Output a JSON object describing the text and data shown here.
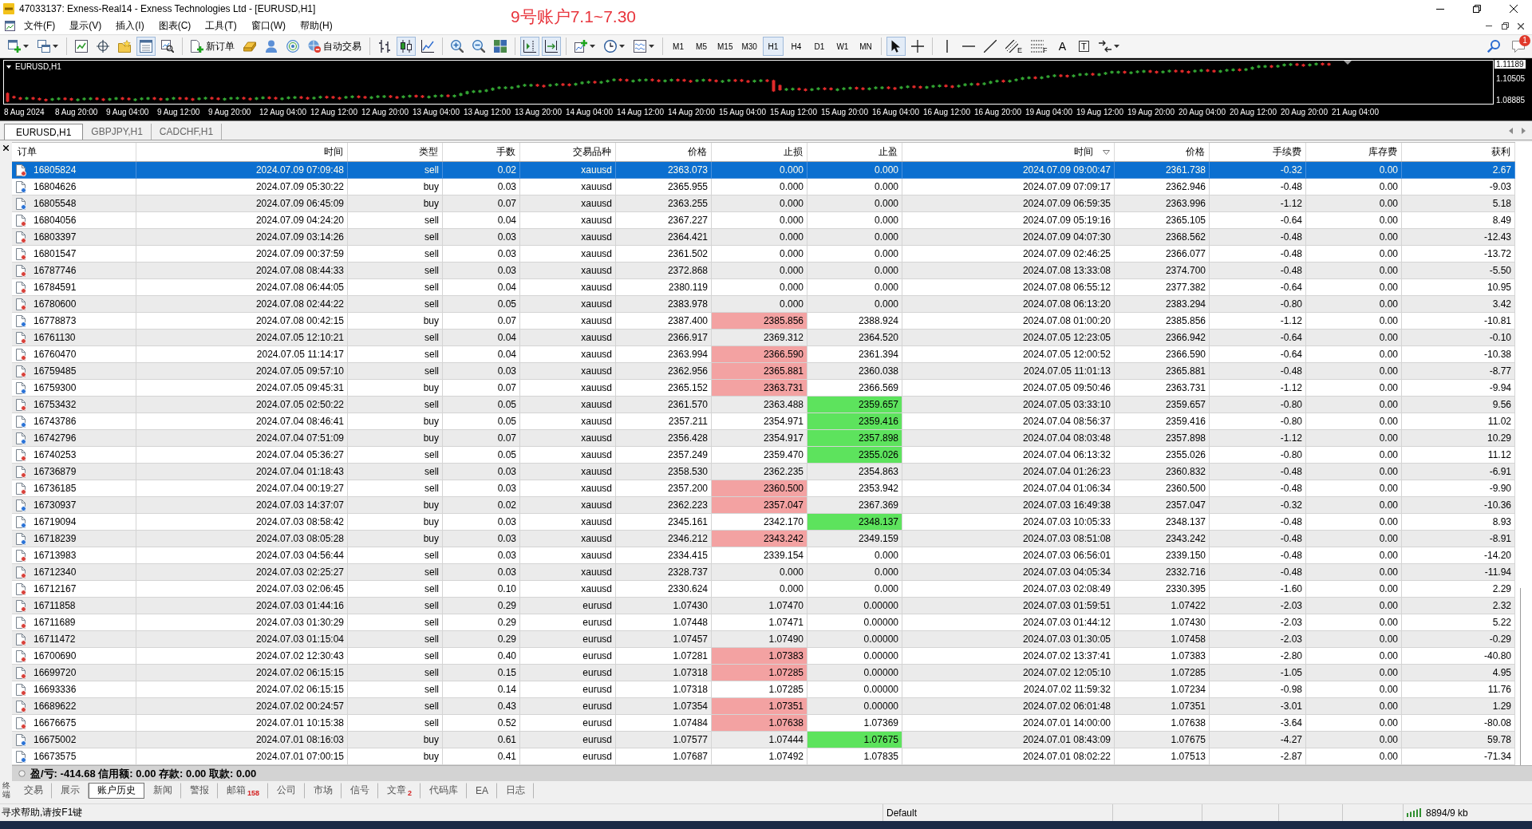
{
  "window": {
    "title": "47033137: Exness-Real14 - Exness Technologies Ltd - [EURUSD,H1]"
  },
  "annotation": "9号账户7.1~7.30",
  "menu": [
    "文件(F)",
    "显示(V)",
    "插入(I)",
    "图表(C)",
    "工具(T)",
    "窗口(W)",
    "帮助(H)"
  ],
  "toolbar": [
    [
      {
        "kind": "newchart",
        "on": false,
        "dropdown": true
      },
      {
        "kind": "profiles",
        "on": false,
        "dropdown": true
      }
    ],
    [
      {
        "kind": "marketwatch",
        "on": false
      },
      {
        "kind": "datawindow",
        "on": false
      },
      {
        "kind": "navigator",
        "on": false
      },
      {
        "kind": "terminal",
        "on": true
      },
      {
        "kind": "tester",
        "on": false
      }
    ],
    [
      {
        "kind": "neworder",
        "label": "新订单",
        "on": false
      },
      {
        "kind": "editor",
        "on": false
      },
      {
        "kind": "account",
        "on": false
      },
      {
        "kind": "signals",
        "on": false
      },
      {
        "kind": "autotrading",
        "label": "自动交易",
        "on": false
      }
    ],
    [
      {
        "kind": "bars",
        "on": false
      },
      {
        "kind": "candles",
        "on": true
      },
      {
        "kind": "line",
        "on": false
      }
    ],
    [
      {
        "kind": "zoomin",
        "on": false
      },
      {
        "kind": "zoomout",
        "on": false
      },
      {
        "kind": "tile",
        "on": false
      }
    ],
    [
      {
        "kind": "shift",
        "on": true
      },
      {
        "kind": "autoscroll",
        "on": true
      }
    ],
    [
      {
        "kind": "indicators",
        "on": false,
        "dropdown": true
      },
      {
        "kind": "periods",
        "on": false,
        "dropdown": true
      },
      {
        "kind": "templates",
        "on": false,
        "dropdown": true
      }
    ],
    [
      {
        "kind": "timeframe",
        "label": "M1",
        "on": false
      },
      {
        "kind": "timeframe",
        "label": "M5",
        "on": false
      },
      {
        "kind": "timeframe",
        "label": "M15",
        "on": false
      },
      {
        "kind": "timeframe",
        "label": "M30",
        "on": false
      },
      {
        "kind": "timeframe",
        "label": "H1",
        "on": true
      },
      {
        "kind": "timeframe",
        "label": "H4",
        "on": false
      },
      {
        "kind": "timeframe",
        "label": "D1",
        "on": false
      },
      {
        "kind": "timeframe",
        "label": "W1",
        "on": false
      },
      {
        "kind": "timeframe",
        "label": "MN",
        "on": false
      }
    ],
    [
      {
        "kind": "cursor",
        "on": true
      },
      {
        "kind": "crosshair",
        "on": false
      }
    ],
    [
      {
        "kind": "vline",
        "on": false
      },
      {
        "kind": "hline",
        "on": false
      },
      {
        "kind": "trendline",
        "on": false
      },
      {
        "kind": "channel",
        "label": "E",
        "on": false
      },
      {
        "kind": "fibo",
        "label": "F",
        "on": false
      },
      {
        "kind": "text",
        "label": "A",
        "on": false
      },
      {
        "kind": "label",
        "label": "T",
        "on": false
      },
      {
        "kind": "arrows",
        "on": false,
        "dropdown": true
      }
    ]
  ],
  "toolbar_right": [
    {
      "kind": "search"
    },
    {
      "kind": "alerts",
      "badge": "1"
    }
  ],
  "chart": {
    "symbol": "EURUSD,H1",
    "price_labels": [
      {
        "text": "1.11189",
        "current": true
      },
      {
        "text": "1.10505",
        "current": false
      },
      {
        "text": "1.08885",
        "current": false
      }
    ],
    "time_labels": [
      "8 Aug 2024",
      "8 Aug 20:00",
      "9 Aug 04:00",
      "9 Aug 12:00",
      "9 Aug 20:00",
      "12 Aug 04:00",
      "12 Aug 12:00",
      "12 Aug 20:00",
      "13 Aug 04:00",
      "13 Aug 12:00",
      "13 Aug 20:00",
      "14 Aug 04:00",
      "14 Aug 12:00",
      "14 Aug 20:00",
      "15 Aug 04:00",
      "15 Aug 12:00",
      "15 Aug 20:00",
      "16 Aug 04:00",
      "16 Aug 12:00",
      "16 Aug 20:00",
      "19 Aug 04:00",
      "19 Aug 12:00",
      "19 Aug 20:00",
      "20 Aug 04:00",
      "20 Aug 12:00",
      "20 Aug 20:00",
      "21 Aug 04:00"
    ]
  },
  "chart_tabs": [
    {
      "label": "EURUSD,H1",
      "selected": true
    },
    {
      "label": "GBPJPY,H1",
      "selected": false
    },
    {
      "label": "CADCHF,H1",
      "selected": false
    }
  ],
  "table": {
    "columns": [
      {
        "label": "订单",
        "sorted": false
      },
      {
        "label": "时间",
        "sorted": false
      },
      {
        "label": "类型",
        "sorted": false
      },
      {
        "label": "手数",
        "sorted": false
      },
      {
        "label": "交易品种",
        "sorted": false
      },
      {
        "label": "价格",
        "sorted": false
      },
      {
        "label": "止损",
        "sorted": false
      },
      {
        "label": "止盈",
        "sorted": false
      },
      {
        "label": "时间",
        "sorted": true
      },
      {
        "label": "价格",
        "sorted": false
      },
      {
        "label": "手续费",
        "sorted": false
      },
      {
        "label": "库存费",
        "sorted": false
      },
      {
        "label": "获利",
        "sorted": false
      }
    ],
    "rows": [
      {
        "kind": "sell",
        "selected": true,
        "sl_hit": false,
        "tp_hit": false,
        "cells": [
          "16805824",
          "2024.07.09 07:09:48",
          "sell",
          "0.02",
          "xauusd",
          "2363.073",
          "0.000",
          "0.000",
          "2024.07.09 09:00:47",
          "2361.738",
          "-0.32",
          "0.00",
          "2.67"
        ]
      },
      {
        "kind": "buy",
        "selected": false,
        "sl_hit": false,
        "tp_hit": false,
        "cells": [
          "16804626",
          "2024.07.09 05:30:22",
          "buy",
          "0.03",
          "xauusd",
          "2365.955",
          "0.000",
          "0.000",
          "2024.07.09 07:09:17",
          "2362.946",
          "-0.48",
          "0.00",
          "-9.03"
        ]
      },
      {
        "kind": "buy",
        "selected": false,
        "sl_hit": false,
        "tp_hit": false,
        "cells": [
          "16805548",
          "2024.07.09 06:45:09",
          "buy",
          "0.07",
          "xauusd",
          "2363.255",
          "0.000",
          "0.000",
          "2024.07.09 06:59:35",
          "2363.996",
          "-1.12",
          "0.00",
          "5.18"
        ]
      },
      {
        "kind": "sell",
        "selected": false,
        "sl_hit": false,
        "tp_hit": false,
        "cells": [
          "16804056",
          "2024.07.09 04:24:20",
          "sell",
          "0.04",
          "xauusd",
          "2367.227",
          "0.000",
          "0.000",
          "2024.07.09 05:19:16",
          "2365.105",
          "-0.64",
          "0.00",
          "8.49"
        ]
      },
      {
        "kind": "sell",
        "selected": false,
        "sl_hit": false,
        "tp_hit": false,
        "cells": [
          "16803397",
          "2024.07.09 03:14:26",
          "sell",
          "0.03",
          "xauusd",
          "2364.421",
          "0.000",
          "0.000",
          "2024.07.09 04:07:30",
          "2368.562",
          "-0.48",
          "0.00",
          "-12.43"
        ]
      },
      {
        "kind": "sell",
        "selected": false,
        "sl_hit": false,
        "tp_hit": false,
        "cells": [
          "16801547",
          "2024.07.09 00:37:59",
          "sell",
          "0.03",
          "xauusd",
          "2361.502",
          "0.000",
          "0.000",
          "2024.07.09 02:46:25",
          "2366.077",
          "-0.48",
          "0.00",
          "-13.72"
        ]
      },
      {
        "kind": "sell",
        "selected": false,
        "sl_hit": false,
        "tp_hit": false,
        "cells": [
          "16787746",
          "2024.07.08 08:44:33",
          "sell",
          "0.03",
          "xauusd",
          "2372.868",
          "0.000",
          "0.000",
          "2024.07.08 13:33:08",
          "2374.700",
          "-0.48",
          "0.00",
          "-5.50"
        ]
      },
      {
        "kind": "sell",
        "selected": false,
        "sl_hit": false,
        "tp_hit": false,
        "cells": [
          "16784591",
          "2024.07.08 06:44:05",
          "sell",
          "0.04",
          "xauusd",
          "2380.119",
          "0.000",
          "0.000",
          "2024.07.08 06:55:12",
          "2377.382",
          "-0.64",
          "0.00",
          "10.95"
        ]
      },
      {
        "kind": "sell",
        "selected": false,
        "sl_hit": false,
        "tp_hit": false,
        "cells": [
          "16780600",
          "2024.07.08 02:44:22",
          "sell",
          "0.05",
          "xauusd",
          "2383.978",
          "0.000",
          "0.000",
          "2024.07.08 06:13:20",
          "2383.294",
          "-0.80",
          "0.00",
          "3.42"
        ]
      },
      {
        "kind": "buy",
        "selected": false,
        "sl_hit": true,
        "tp_hit": false,
        "cells": [
          "16778873",
          "2024.07.08 00:42:15",
          "buy",
          "0.07",
          "xauusd",
          "2387.400",
          "2385.856",
          "2388.924",
          "2024.07.08 01:00:20",
          "2385.856",
          "-1.12",
          "0.00",
          "-10.81"
        ]
      },
      {
        "kind": "sell",
        "selected": false,
        "sl_hit": false,
        "tp_hit": false,
        "cells": [
          "16761130",
          "2024.07.05 12:10:21",
          "sell",
          "0.04",
          "xauusd",
          "2366.917",
          "2369.312",
          "2364.520",
          "2024.07.05 12:23:05",
          "2366.942",
          "-0.64",
          "0.00",
          "-0.10"
        ]
      },
      {
        "kind": "sell",
        "selected": false,
        "sl_hit": true,
        "tp_hit": false,
        "cells": [
          "16760470",
          "2024.07.05 11:14:17",
          "sell",
          "0.04",
          "xauusd",
          "2363.994",
          "2366.590",
          "2361.394",
          "2024.07.05 12:00:52",
          "2366.590",
          "-0.64",
          "0.00",
          "-10.38"
        ]
      },
      {
        "kind": "sell",
        "selected": false,
        "sl_hit": true,
        "tp_hit": false,
        "cells": [
          "16759485",
          "2024.07.05 09:57:10",
          "sell",
          "0.03",
          "xauusd",
          "2362.956",
          "2365.881",
          "2360.038",
          "2024.07.05 11:01:13",
          "2365.881",
          "-0.48",
          "0.00",
          "-8.77"
        ]
      },
      {
        "kind": "buy",
        "selected": false,
        "sl_hit": true,
        "tp_hit": false,
        "cells": [
          "16759300",
          "2024.07.05 09:45:31",
          "buy",
          "0.07",
          "xauusd",
          "2365.152",
          "2363.731",
          "2366.569",
          "2024.07.05 09:50:46",
          "2363.731",
          "-1.12",
          "0.00",
          "-9.94"
        ]
      },
      {
        "kind": "sell",
        "selected": false,
        "sl_hit": false,
        "tp_hit": true,
        "cells": [
          "16753432",
          "2024.07.05 02:50:22",
          "sell",
          "0.05",
          "xauusd",
          "2361.570",
          "2363.488",
          "2359.657",
          "2024.07.05 03:33:10",
          "2359.657",
          "-0.80",
          "0.00",
          "9.56"
        ]
      },
      {
        "kind": "buy",
        "selected": false,
        "sl_hit": false,
        "tp_hit": true,
        "cells": [
          "16743786",
          "2024.07.04 08:46:41",
          "buy",
          "0.05",
          "xauusd",
          "2357.211",
          "2354.971",
          "2359.416",
          "2024.07.04 08:56:37",
          "2359.416",
          "-0.80",
          "0.00",
          "11.02"
        ]
      },
      {
        "kind": "buy",
        "selected": false,
        "sl_hit": false,
        "tp_hit": true,
        "cells": [
          "16742796",
          "2024.07.04 07:51:09",
          "buy",
          "0.07",
          "xauusd",
          "2356.428",
          "2354.917",
          "2357.898",
          "2024.07.04 08:03:48",
          "2357.898",
          "-1.12",
          "0.00",
          "10.29"
        ]
      },
      {
        "kind": "sell",
        "selected": false,
        "sl_hit": false,
        "tp_hit": true,
        "cells": [
          "16740253",
          "2024.07.04 05:36:27",
          "sell",
          "0.05",
          "xauusd",
          "2357.249",
          "2359.470",
          "2355.026",
          "2024.07.04 06:13:32",
          "2355.026",
          "-0.80",
          "0.00",
          "11.12"
        ]
      },
      {
        "kind": "sell",
        "selected": false,
        "sl_hit": false,
        "tp_hit": false,
        "cells": [
          "16736879",
          "2024.07.04 01:18:43",
          "sell",
          "0.03",
          "xauusd",
          "2358.530",
          "2362.235",
          "2354.863",
          "2024.07.04 01:26:23",
          "2360.832",
          "-0.48",
          "0.00",
          "-6.91"
        ]
      },
      {
        "kind": "sell",
        "selected": false,
        "sl_hit": true,
        "tp_hit": false,
        "cells": [
          "16736185",
          "2024.07.04 00:19:27",
          "sell",
          "0.03",
          "xauusd",
          "2357.200",
          "2360.500",
          "2353.942",
          "2024.07.04 01:06:34",
          "2360.500",
          "-0.48",
          "0.00",
          "-9.90"
        ]
      },
      {
        "kind": "buy",
        "selected": false,
        "sl_hit": true,
        "tp_hit": false,
        "cells": [
          "16730937",
          "2024.07.03 14:37:07",
          "buy",
          "0.02",
          "xauusd",
          "2362.223",
          "2357.047",
          "2367.369",
          "2024.07.03 16:49:38",
          "2357.047",
          "-0.32",
          "0.00",
          "-10.36"
        ]
      },
      {
        "kind": "buy",
        "selected": false,
        "sl_hit": false,
        "tp_hit": true,
        "cells": [
          "16719094",
          "2024.07.03 08:58:42",
          "buy",
          "0.03",
          "xauusd",
          "2345.161",
          "2342.170",
          "2348.137",
          "2024.07.03 10:05:33",
          "2348.137",
          "-0.48",
          "0.00",
          "8.93"
        ]
      },
      {
        "kind": "buy",
        "selected": false,
        "sl_hit": true,
        "tp_hit": false,
        "cells": [
          "16718239",
          "2024.07.03 08:05:28",
          "buy",
          "0.03",
          "xauusd",
          "2346.212",
          "2343.242",
          "2349.159",
          "2024.07.03 08:51:08",
          "2343.242",
          "-0.48",
          "0.00",
          "-8.91"
        ]
      },
      {
        "kind": "sell",
        "selected": false,
        "sl_hit": false,
        "tp_hit": false,
        "cells": [
          "16713983",
          "2024.07.03 04:56:44",
          "sell",
          "0.03",
          "xauusd",
          "2334.415",
          "2339.154",
          "0.000",
          "2024.07.03 06:56:01",
          "2339.150",
          "-0.48",
          "0.00",
          "-14.20"
        ]
      },
      {
        "kind": "sell",
        "selected": false,
        "sl_hit": false,
        "tp_hit": false,
        "cells": [
          "16712340",
          "2024.07.03 02:25:27",
          "sell",
          "0.03",
          "xauusd",
          "2328.737",
          "0.000",
          "0.000",
          "2024.07.03 04:05:34",
          "2332.716",
          "-0.48",
          "0.00",
          "-11.94"
        ]
      },
      {
        "kind": "sell",
        "selected": false,
        "sl_hit": false,
        "tp_hit": false,
        "cells": [
          "16712167",
          "2024.07.03 02:06:45",
          "sell",
          "0.10",
          "xauusd",
          "2330.624",
          "0.000",
          "0.000",
          "2024.07.03 02:08:49",
          "2330.395",
          "-1.60",
          "0.00",
          "2.29"
        ]
      },
      {
        "kind": "sell",
        "selected": false,
        "sl_hit": false,
        "tp_hit": false,
        "cells": [
          "16711858",
          "2024.07.03 01:44:16",
          "sell",
          "0.29",
          "eurusd",
          "1.07430",
          "1.07470",
          "0.00000",
          "2024.07.03 01:59:51",
          "1.07422",
          "-2.03",
          "0.00",
          "2.32"
        ]
      },
      {
        "kind": "sell",
        "selected": false,
        "sl_hit": false,
        "tp_hit": false,
        "cells": [
          "16711689",
          "2024.07.03 01:30:29",
          "sell",
          "0.29",
          "eurusd",
          "1.07448",
          "1.07471",
          "0.00000",
          "2024.07.03 01:44:12",
          "1.07430",
          "-2.03",
          "0.00",
          "5.22"
        ]
      },
      {
        "kind": "sell",
        "selected": false,
        "sl_hit": false,
        "tp_hit": false,
        "cells": [
          "16711472",
          "2024.07.03 01:15:04",
          "sell",
          "0.29",
          "eurusd",
          "1.07457",
          "1.07490",
          "0.00000",
          "2024.07.03 01:30:05",
          "1.07458",
          "-2.03",
          "0.00",
          "-0.29"
        ]
      },
      {
        "kind": "sell",
        "selected": false,
        "sl_hit": true,
        "tp_hit": false,
        "cells": [
          "16700690",
          "2024.07.02 12:30:43",
          "sell",
          "0.40",
          "eurusd",
          "1.07281",
          "1.07383",
          "0.00000",
          "2024.07.02 13:37:41",
          "1.07383",
          "-2.80",
          "0.00",
          "-40.80"
        ]
      },
      {
        "kind": "sell",
        "selected": false,
        "sl_hit": true,
        "tp_hit": false,
        "cells": [
          "16699720",
          "2024.07.02 06:15:15",
          "sell",
          "0.15",
          "eurusd",
          "1.07318",
          "1.07285",
          "0.00000",
          "2024.07.02 12:05:10",
          "1.07285",
          "-1.05",
          "0.00",
          "4.95"
        ]
      },
      {
        "kind": "sell",
        "selected": false,
        "sl_hit": false,
        "tp_hit": false,
        "cells": [
          "16693336",
          "2024.07.02 06:15:15",
          "sell",
          "0.14",
          "eurusd",
          "1.07318",
          "1.07285",
          "0.00000",
          "2024.07.02 11:59:32",
          "1.07234",
          "-0.98",
          "0.00",
          "11.76"
        ]
      },
      {
        "kind": "sell",
        "selected": false,
        "sl_hit": true,
        "tp_hit": false,
        "cells": [
          "16689622",
          "2024.07.02 00:24:57",
          "sell",
          "0.43",
          "eurusd",
          "1.07354",
          "1.07351",
          "0.00000",
          "2024.07.02 06:01:48",
          "1.07351",
          "-3.01",
          "0.00",
          "1.29"
        ]
      },
      {
        "kind": "sell",
        "selected": false,
        "sl_hit": true,
        "tp_hit": false,
        "cells": [
          "16676675",
          "2024.07.01 10:15:38",
          "sell",
          "0.52",
          "eurusd",
          "1.07484",
          "1.07638",
          "1.07369",
          "2024.07.01 14:00:00",
          "1.07638",
          "-3.64",
          "0.00",
          "-80.08"
        ]
      },
      {
        "kind": "buy",
        "selected": false,
        "sl_hit": false,
        "tp_hit": true,
        "cells": [
          "16675002",
          "2024.07.01 08:16:03",
          "buy",
          "0.61",
          "eurusd",
          "1.07577",
          "1.07444",
          "1.07675",
          "2024.07.01 08:43:09",
          "1.07675",
          "-4.27",
          "0.00",
          "59.78"
        ]
      },
      {
        "kind": "buy",
        "selected": false,
        "sl_hit": false,
        "tp_hit": false,
        "cells": [
          "16673575",
          "2024.07.01 07:00:15",
          "buy",
          "0.41",
          "eurusd",
          "1.07687",
          "1.07492",
          "1.07835",
          "2024.07.01 08:02:22",
          "1.07513",
          "-2.87",
          "0.00",
          "-71.34"
        ]
      }
    ]
  },
  "summary": "盈/亏: -414.68 信用额: 0.00 存款: 0.00 取款: 0.00",
  "terminal": {
    "title": "终端"
  },
  "bottom_tabs": [
    {
      "label": "交易",
      "selected": false
    },
    {
      "label": "展示",
      "selected": false
    },
    {
      "label": "账户历史",
      "selected": true
    },
    {
      "label": "新闻",
      "selected": false
    },
    {
      "label": "警报",
      "selected": false
    },
    {
      "label": "邮箱",
      "badge": "158",
      "selected": false
    },
    {
      "label": "公司",
      "selected": false
    },
    {
      "label": "市场",
      "selected": false
    },
    {
      "label": "信号",
      "selected": false
    },
    {
      "label": "文章",
      "badge": "2",
      "selected": false
    },
    {
      "label": "代码库",
      "selected": false
    },
    {
      "label": "EA",
      "selected": false
    },
    {
      "label": "日志",
      "selected": false
    }
  ],
  "status_bar": {
    "help": "寻求帮助,请按F1键",
    "profile": "Default",
    "traffic": "8894/9 kb"
  }
}
